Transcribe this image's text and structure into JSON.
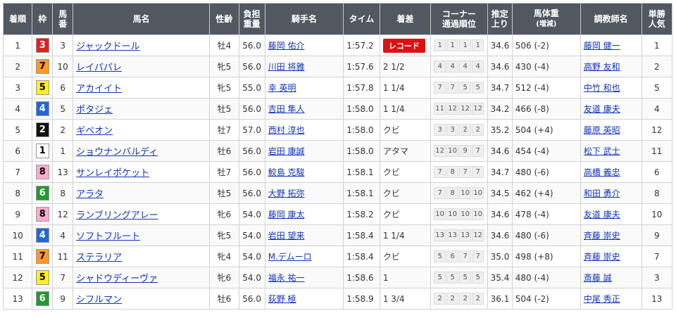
{
  "headers": {
    "rank": "着順",
    "waku": "枠",
    "umaban_1": "馬",
    "umaban_2": "番",
    "horse": "馬名",
    "sex_age": "性齢",
    "weight_carried_1": "負担",
    "weight_carried_2": "重量",
    "jockey": "騎手名",
    "time": "タイム",
    "margin": "着差",
    "corner_1": "コーナー",
    "corner_2": "通過順位",
    "last3f_1": "推定",
    "last3f_2": "上り",
    "body_weight_1": "馬体重",
    "body_weight_2": "(増減)",
    "trainer": "調教師名",
    "odds_1": "単勝",
    "odds_2": "人気"
  },
  "waku_colors": {
    "1": {
      "bg": "#ffffff",
      "fg": "#000000"
    },
    "2": {
      "bg": "#111111",
      "fg": "#ffffff"
    },
    "3": {
      "bg": "#dd2222",
      "fg": "#ffffff"
    },
    "4": {
      "bg": "#2266dd",
      "fg": "#ffffff"
    },
    "5": {
      "bg": "#ffee22",
      "fg": "#000000"
    },
    "6": {
      "bg": "#229933",
      "fg": "#ffffff"
    },
    "7": {
      "bg": "#ff9922",
      "fg": "#000000"
    },
    "8": {
      "bg": "#ffaacc",
      "fg": "#000000"
    }
  },
  "rows": [
    {
      "rank": "1",
      "waku": "3",
      "umaban": "3",
      "horse": "ジャックドール",
      "sex_age": "牡4",
      "weight": "56.0",
      "jockey": "藤岡 佑介",
      "time": "1:57.2",
      "margin": "",
      "record": "レコード",
      "corner": [
        "1",
        "1",
        "1",
        "1"
      ],
      "last3f": "34.6",
      "body_weight": "506 (-2)",
      "trainer": "藤岡 健一",
      "popularity": "1"
    },
    {
      "rank": "2",
      "waku": "7",
      "umaban": "10",
      "horse": "レイパパレ",
      "sex_age": "牝5",
      "weight": "56.0",
      "jockey": "川田 将雅",
      "time": "1:57.6",
      "margin": "2 1/2",
      "record": "",
      "corner": [
        "4",
        "4",
        "4",
        "4"
      ],
      "last3f": "34.6",
      "body_weight": "430 (-4)",
      "trainer": "高野 友和",
      "popularity": "2"
    },
    {
      "rank": "3",
      "waku": "5",
      "umaban": "6",
      "horse": "アカイイト",
      "sex_age": "牝5",
      "weight": "55.0",
      "jockey": "幸 英明",
      "time": "1:57.8",
      "margin": "1 1/4",
      "record": "",
      "corner": [
        "7",
        "7",
        "5",
        "5"
      ],
      "last3f": "34.7",
      "body_weight": "512 (-4)",
      "trainer": "中竹 和也",
      "popularity": "5"
    },
    {
      "rank": "4",
      "waku": "4",
      "umaban": "5",
      "horse": "ポタジェ",
      "sex_age": "牡5",
      "weight": "56.0",
      "jockey": "吉田 隼人",
      "time": "1:58.0",
      "margin": "1 1/4",
      "record": "",
      "corner": [
        "11",
        "12",
        "12",
        "12"
      ],
      "last3f": "34.2",
      "body_weight": "466 (-8)",
      "trainer": "友道 康夫",
      "popularity": "4"
    },
    {
      "rank": "5",
      "waku": "2",
      "umaban": "2",
      "horse": "ギベオン",
      "sex_age": "牡7",
      "weight": "57.0",
      "jockey": "西村 淳也",
      "time": "1:58.0",
      "margin": "クビ",
      "record": "",
      "corner": [
        "3",
        "3",
        "2",
        "2"
      ],
      "last3f": "35.2",
      "body_weight": "504 (+4)",
      "trainer": "藤原 英昭",
      "popularity": "12"
    },
    {
      "rank": "6",
      "waku": "1",
      "umaban": "1",
      "horse": "ショウナンバルディ",
      "sex_age": "牡6",
      "weight": "56.0",
      "jockey": "岩田 康誠",
      "time": "1:58.0",
      "margin": "アタマ",
      "record": "",
      "corner": [
        "12",
        "10",
        "9",
        "7"
      ],
      "last3f": "34.6",
      "body_weight": "454 (-4)",
      "trainer": "松下 武士",
      "popularity": "11"
    },
    {
      "rank": "7",
      "waku": "8",
      "umaban": "13",
      "horse": "サンレイポケット",
      "sex_age": "牡7",
      "weight": "56.0",
      "jockey": "鮫島 克駿",
      "time": "1:58.1",
      "margin": "クビ",
      "record": "",
      "corner": [
        "7",
        "8",
        "7",
        "7"
      ],
      "last3f": "34.7",
      "body_weight": "480 (-6)",
      "trainer": "高橋 義忠",
      "popularity": "6"
    },
    {
      "rank": "8",
      "waku": "6",
      "umaban": "8",
      "horse": "アラタ",
      "sex_age": "牡5",
      "weight": "56.0",
      "jockey": "大野 拓弥",
      "time": "1:58.1",
      "margin": "クビ",
      "record": "",
      "corner": [
        "7",
        "8",
        "10",
        "10"
      ],
      "last3f": "34.5",
      "body_weight": "462 (+4)",
      "trainer": "和田 勇介",
      "popularity": "8"
    },
    {
      "rank": "9",
      "waku": "8",
      "umaban": "12",
      "horse": "ランブリングアレー",
      "sex_age": "牝6",
      "weight": "54.0",
      "jockey": "藤岡 康太",
      "time": "1:58.2",
      "margin": "クビ",
      "record": "",
      "corner": [
        "10",
        "10",
        "10",
        "10"
      ],
      "last3f": "34.6",
      "body_weight": "478 (-4)",
      "trainer": "友道 康夫",
      "popularity": "10"
    },
    {
      "rank": "10",
      "waku": "4",
      "umaban": "4",
      "horse": "ソフトフルート",
      "sex_age": "牝5",
      "weight": "54.0",
      "jockey": "岩田 望来",
      "time": "1:58.4",
      "margin": "1 1/4",
      "record": "",
      "corner": [
        "13",
        "13",
        "13",
        "12"
      ],
      "last3f": "34.6",
      "body_weight": "480 (-6)",
      "trainer": "斉藤 崇史",
      "popularity": "9"
    },
    {
      "rank": "11",
      "waku": "7",
      "umaban": "11",
      "horse": "ステラリア",
      "sex_age": "牝4",
      "weight": "54.0",
      "jockey": "M.デムーロ",
      "time": "1:58.4",
      "margin": "クビ",
      "record": "",
      "corner": [
        "5",
        "6",
        "7",
        "7"
      ],
      "last3f": "35.0",
      "body_weight": "498 (+8)",
      "trainer": "斉藤 崇史",
      "popularity": "7"
    },
    {
      "rank": "12",
      "waku": "5",
      "umaban": "7",
      "horse": "シャドウディーヴァ",
      "sex_age": "牝6",
      "weight": "54.0",
      "jockey": "福永 祐一",
      "time": "1:58.6",
      "margin": "1",
      "record": "",
      "corner": [
        "5",
        "5",
        "5",
        "5"
      ],
      "last3f": "35.4",
      "body_weight": "480 (-4)",
      "trainer": "斎藤 誠",
      "popularity": "3"
    },
    {
      "rank": "13",
      "waku": "6",
      "umaban": "9",
      "horse": "シフルマン",
      "sex_age": "牡6",
      "weight": "56.0",
      "jockey": "荻野 極",
      "time": "1:58.9",
      "margin": "1 3/4",
      "record": "",
      "corner": [
        "2",
        "2",
        "2",
        "2"
      ],
      "last3f": "36.1",
      "body_weight": "504 (-2)",
      "trainer": "中尾 秀正",
      "popularity": "13"
    }
  ]
}
